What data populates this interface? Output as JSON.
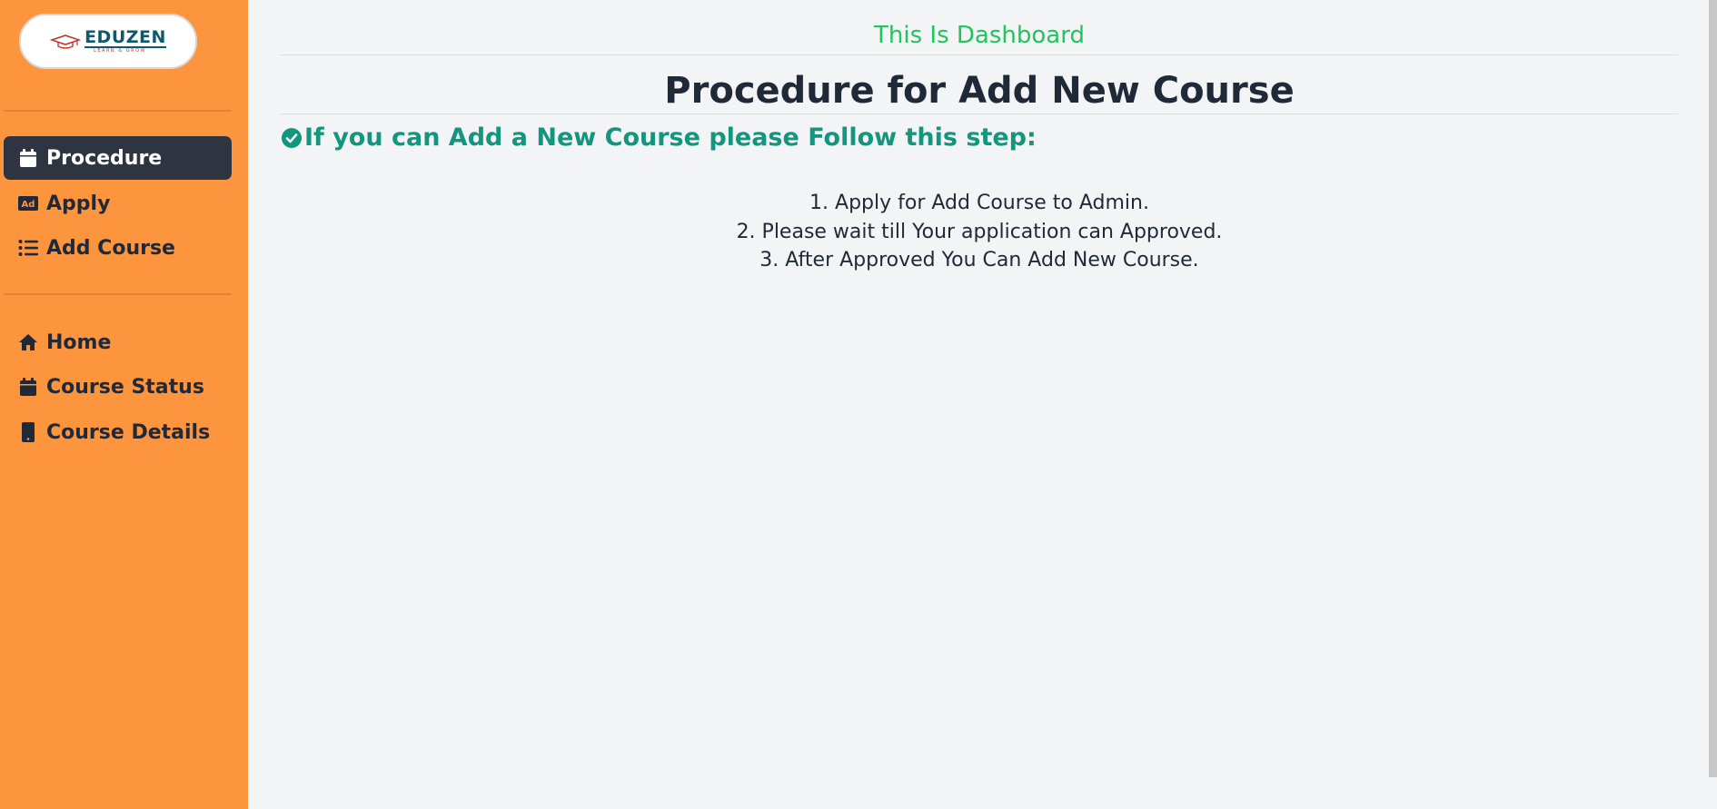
{
  "logo": {
    "text": "EDUZEN",
    "tagline": "LEARN & GROW"
  },
  "sidebar": {
    "primary_items": [
      {
        "label": "Procedure",
        "icon": "calendar-icon",
        "active": true
      },
      {
        "label": "Apply",
        "icon": "ad-icon",
        "active": false
      },
      {
        "label": "Add Course",
        "icon": "list-icon",
        "active": false
      }
    ],
    "secondary_items": [
      {
        "label": "Home",
        "icon": "home-icon"
      },
      {
        "label": "Course Status",
        "icon": "calendar-icon"
      },
      {
        "label": "Course Details",
        "icon": "mobile-icon"
      }
    ]
  },
  "main": {
    "dashboard_label": "This Is Dashboard",
    "title": "Procedure for Add New Course",
    "instruction": "If you can Add a New Course please Follow this step:",
    "steps": [
      "1. Apply for Add Course to Admin.",
      "2. Please wait till Your application can Approved.",
      "3. After Approved You Can Add New Course."
    ]
  },
  "colors": {
    "sidebar_bg": "#fd943e",
    "active_item_bg": "#2f3441",
    "dashboard_green": "#21c45d",
    "instruction_teal": "#14957d",
    "text_dark": "#1f2937"
  }
}
